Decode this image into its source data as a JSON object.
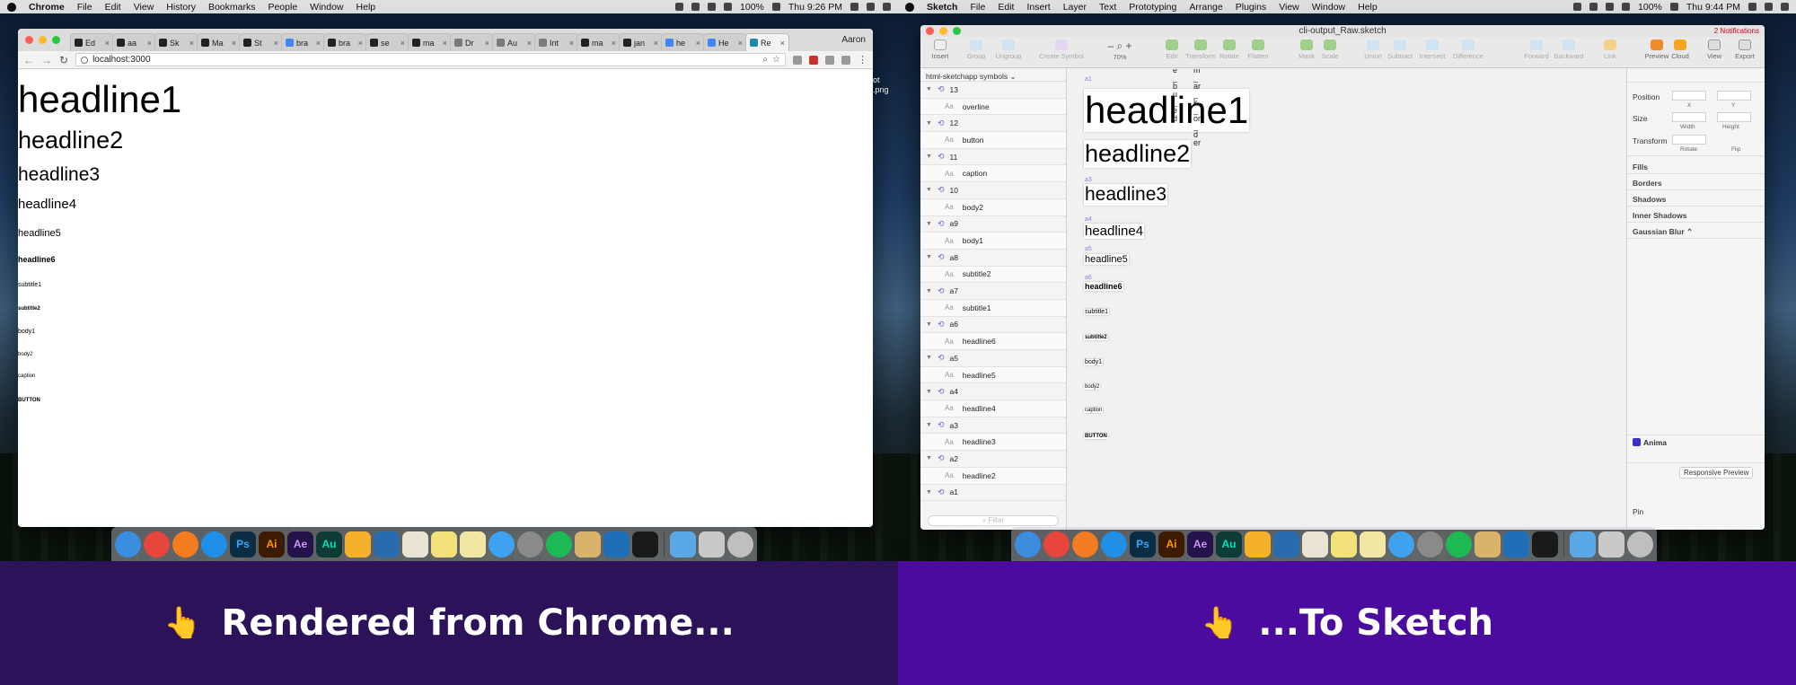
{
  "left": {
    "menubar": {
      "app": "Chrome",
      "items": [
        "File",
        "Edit",
        "View",
        "History",
        "Bookmarks",
        "People",
        "Window",
        "Help"
      ],
      "battery": "100%",
      "clock": "Thu 9:26 PM"
    },
    "chrome": {
      "tabs": [
        {
          "label": "Ed",
          "icon": "medium-icon"
        },
        {
          "label": "aa",
          "icon": "github-icon"
        },
        {
          "label": "Sk",
          "icon": "medium-icon"
        },
        {
          "label": "Ma",
          "icon": "medium-icon"
        },
        {
          "label": "St",
          "icon": "medium-icon"
        },
        {
          "label": "bra",
          "icon": "google-icon"
        },
        {
          "label": "bra",
          "icon": "github-icon"
        },
        {
          "label": "se",
          "icon": "github-icon"
        },
        {
          "label": "ma",
          "icon": "github-icon"
        },
        {
          "label": "Dr",
          "icon": "page-icon"
        },
        {
          "label": "Au",
          "icon": "page-icon"
        },
        {
          "label": "Int",
          "icon": "page-icon"
        },
        {
          "label": "ma",
          "icon": "github-icon"
        },
        {
          "label": "jan",
          "icon": "github-icon"
        },
        {
          "label": "he",
          "icon": "google-icon"
        },
        {
          "label": "He",
          "icon": "google-icon"
        },
        {
          "label": "Re",
          "icon": "react-icon",
          "active": true
        }
      ],
      "profile": "Aaron",
      "url": "localhost:3000",
      "text_styles": [
        {
          "key": "headline1",
          "label": "headline1"
        },
        {
          "key": "headline2",
          "label": "headline2"
        },
        {
          "key": "headline3",
          "label": "headline3"
        },
        {
          "key": "headline4",
          "label": "headline4"
        },
        {
          "key": "headline5",
          "label": "headline5"
        },
        {
          "key": "headline6",
          "label": "headline6"
        },
        {
          "key": "subtitle1",
          "label": "subtitle1"
        },
        {
          "key": "subtitle2",
          "label": "subtitle2"
        },
        {
          "key": "body1",
          "label": "body1"
        },
        {
          "key": "body2",
          "label": "body2"
        },
        {
          "key": "caption",
          "label": "caption"
        },
        {
          "key": "button",
          "label": "BUTTON"
        }
      ]
    },
    "desktop_file_label": "ot\n.png",
    "caption_text": "Rendered from Chrome...",
    "caption_emoji": "👆"
  },
  "right": {
    "menubar": {
      "app": "Sketch",
      "items": [
        "File",
        "Edit",
        "Insert",
        "Layer",
        "Text",
        "Prototyping",
        "Arrange",
        "Plugins",
        "View",
        "Window",
        "Help"
      ],
      "battery": "100%",
      "clock": "Thu 9:44 PM"
    },
    "sketch": {
      "title": "cli-output_Raw.sketch",
      "notifications": "2 Notifications",
      "tools": {
        "insert": "Insert",
        "group": "Group",
        "ungroup": "Ungroup",
        "create_symbol": "Create Symbol",
        "zoom": "70%",
        "edit": "Edit",
        "transform": "Transform",
        "rotate": "Rotate",
        "flatten": "Flatten",
        "mask": "Mask",
        "scale": "Scale",
        "union": "Union",
        "subtract": "Subtract",
        "intersect": "Intersect",
        "difference": "Difference",
        "forward": "Forward",
        "backward": "Backward",
        "link": "Link",
        "preview": "Preview",
        "cloud": "Cloud",
        "view": "View",
        "export": "Export"
      },
      "page_name": "html-sketchapp symbols",
      "layers": [
        {
          "group": "13",
          "child": "overline"
        },
        {
          "group": "12",
          "child": "button"
        },
        {
          "group": "11",
          "child": "caption"
        },
        {
          "group": "10",
          "child": "body2"
        },
        {
          "group": "a9",
          "child": "body1"
        },
        {
          "group": "a8",
          "child": "subtitle2"
        },
        {
          "group": "a7",
          "child": "subtitle1"
        },
        {
          "group": "a6",
          "child": "headline6"
        },
        {
          "group": "a5",
          "child": "headline5"
        },
        {
          "group": "a4",
          "child": "headline4"
        },
        {
          "group": "a3",
          "child": "headline3"
        },
        {
          "group": "a2",
          "child": "headline2"
        },
        {
          "group": "a1",
          "child": ""
        }
      ],
      "filter_placeholder": "Filter",
      "canvas_labels": [
        "a1",
        "a2",
        "a3",
        "a4",
        "a5",
        "a6"
      ],
      "canvas_texts": [
        {
          "key": "headline1",
          "label": "headline1"
        },
        {
          "key": "headline2",
          "label": "headline2"
        },
        {
          "key": "headline3",
          "label": "headline3"
        },
        {
          "key": "headline4",
          "label": "headline4"
        },
        {
          "key": "headline5",
          "label": "headline5"
        },
        {
          "key": "headline6",
          "label": "headline6"
        },
        {
          "key": "subtitle1",
          "label": "subtitle1"
        },
        {
          "key": "subtitle2",
          "label": "subtitle2"
        },
        {
          "key": "body1",
          "label": "body1"
        },
        {
          "key": "body2",
          "label": "body2"
        },
        {
          "key": "caption",
          "label": "caption"
        },
        {
          "key": "button",
          "label": "BUTTON"
        }
      ],
      "vertical_texts": [
        "e_bu_ed",
        "m_ar_k_or_der"
      ],
      "inspector": {
        "position": "Position",
        "x": "X",
        "y": "Y",
        "size": "Size",
        "width": "Width",
        "height": "Height",
        "transform": "Transform",
        "rotate": "Rotate",
        "flip": "Flip",
        "fills": "Fills",
        "borders": "Borders",
        "shadows": "Shadows",
        "inner_shadows": "Inner Shadows",
        "gaussian_blur": "Gaussian Blur",
        "anima": "Anima",
        "responsive_preview": "Responsive Preview",
        "pin": "Pin"
      }
    },
    "caption_text": "...To Sketch",
    "caption_emoji": "👆"
  },
  "dock_apps": [
    {
      "name": "finder",
      "glyph": "",
      "color": "#3b8de0"
    },
    {
      "name": "chrome",
      "glyph": "",
      "color": "#e8453c"
    },
    {
      "name": "firefox",
      "glyph": "",
      "color": "#f47c20"
    },
    {
      "name": "safari",
      "glyph": "",
      "color": "#1f8fe8"
    },
    {
      "name": "photoshop",
      "glyph": "Ps",
      "color": "#0b2c42"
    },
    {
      "name": "illustrator",
      "glyph": "Ai",
      "color": "#3d1a02"
    },
    {
      "name": "after-effects",
      "glyph": "Ae",
      "color": "#24124a"
    },
    {
      "name": "audition",
      "glyph": "Au",
      "color": "#0d3b36"
    },
    {
      "name": "sketch",
      "glyph": "",
      "color": "#f6b02b"
    },
    {
      "name": "xcode",
      "glyph": "",
      "color": "#2a6bb0"
    },
    {
      "name": "textedit",
      "glyph": "",
      "color": "#e9e4d4"
    },
    {
      "name": "stickies",
      "glyph": "",
      "color": "#f3e27a"
    },
    {
      "name": "notes",
      "glyph": "",
      "color": "#f1e6a4"
    },
    {
      "name": "messages",
      "glyph": "",
      "color": "#3fa2f0"
    },
    {
      "name": "system-prefs",
      "glyph": "",
      "color": "#8a8a8a"
    },
    {
      "name": "spotify",
      "glyph": "",
      "color": "#1db954"
    },
    {
      "name": "archive",
      "glyph": "",
      "color": "#d9b36b"
    },
    {
      "name": "vscode",
      "glyph": "",
      "color": "#1e6fb8"
    },
    {
      "name": "terminal",
      "glyph": "",
      "color": "#1a1a1a"
    },
    {
      "name": "downloads",
      "glyph": "",
      "color": "#5ba8e6"
    },
    {
      "name": "screenshot",
      "glyph": "",
      "color": "#c9c9c9"
    },
    {
      "name": "trash",
      "glyph": "",
      "color": "#bfbfbf"
    }
  ],
  "colors": {
    "caption_left_bg": "#2c1258",
    "caption_right_bg": "#4a0b9e",
    "artboard_label": "#9b7ad6",
    "symbol_icon": "#7a5fd0"
  }
}
